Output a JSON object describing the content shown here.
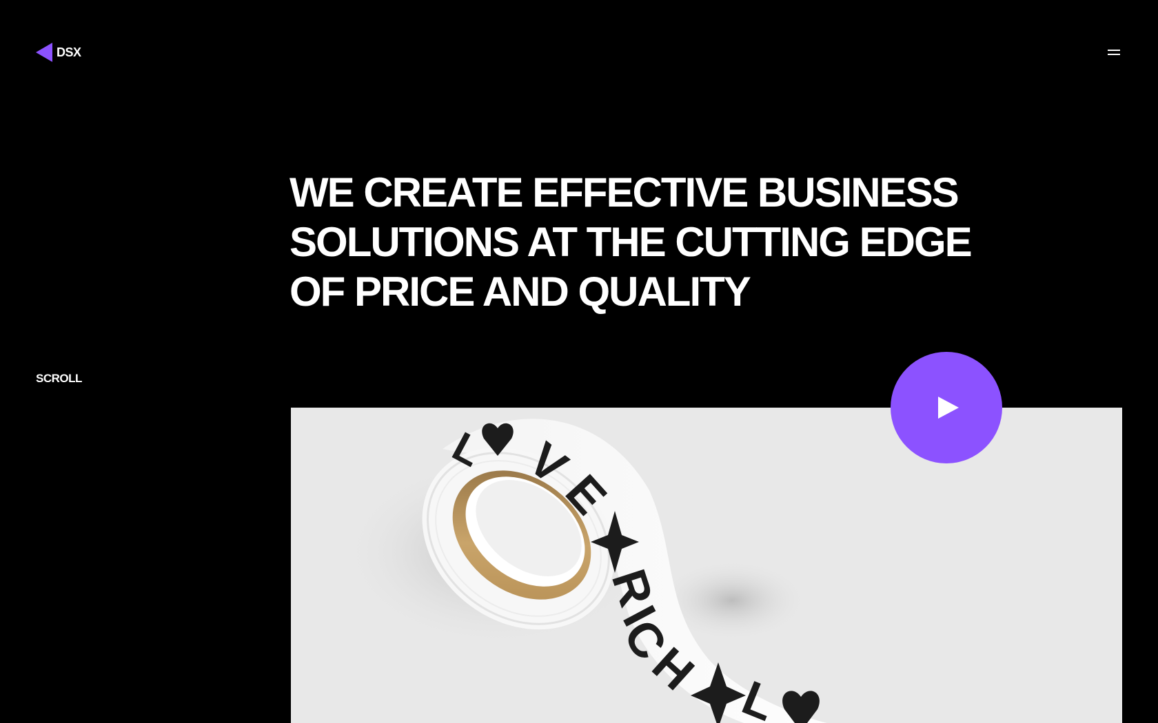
{
  "header": {
    "logo_text": "DSX",
    "logo_icon": "triangle-left-icon",
    "menu_icon": "hamburger-menu-icon"
  },
  "hero": {
    "headline_lines": [
      "WE CREATE EFFECTIVE BUSINESS",
      "SOLUTIONS AT THE CUTTING EDGE",
      "OF PRICE AND QUALITY"
    ],
    "scroll_label": "SCROLL",
    "play_icon": "play-icon",
    "image_subject": "tape-roll-photo",
    "image_tape_text": "LOVE RICH"
  },
  "colors": {
    "background": "#000000",
    "text": "#ffffff",
    "accent": "#8c52ff",
    "image_background": "#e8e8e8"
  }
}
